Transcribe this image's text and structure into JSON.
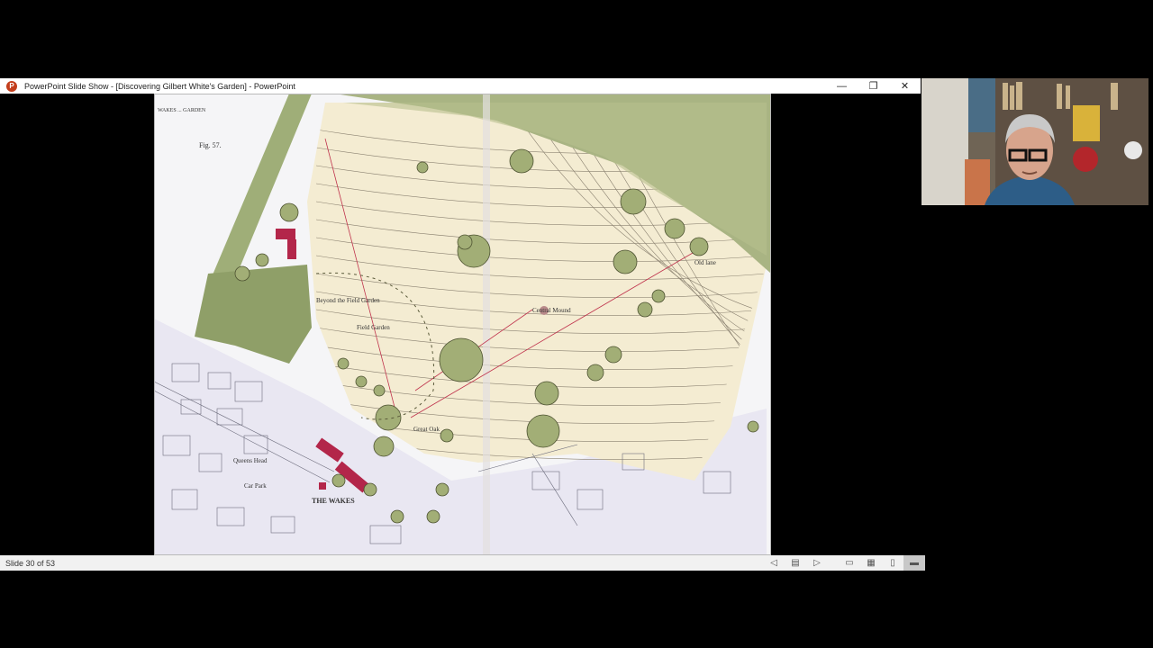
{
  "window": {
    "app_icon": "P",
    "title": "PowerPoint Slide Show - [Discovering Gilbert White's Garden] - PowerPoint",
    "controls": {
      "minimize": "—",
      "restore": "❐",
      "close": "✕"
    }
  },
  "slide": {
    "map_labels": {
      "fig": "Fig. 57.",
      "the_wakes": "THE WAKES",
      "central_mound": "Central Mound",
      "field_garden": "Field Garden",
      "beyond_the_field": "Beyond the Field Garden",
      "great_oak": "Great Oak",
      "old_lane": "Old lane",
      "queens_head": "Queens Head",
      "car_park": "Car Park",
      "wakes_header": "WAKES ... GARDEN"
    }
  },
  "statusbar": {
    "slide_counter": "Slide 30 of 53",
    "icons": [
      "previous-icon",
      "slide-menu-icon",
      "next-icon",
      "normal-view-icon",
      "slide-sorter-icon",
      "reading-view-icon",
      "slideshow-icon"
    ]
  },
  "colors": {
    "titlebar_bg": "#ffffff",
    "statusbar_bg": "#f1f1f1",
    "app_accent": "#c43e1c",
    "map_green": "#9fae78",
    "map_parchment": "#f4ecd2",
    "building_red": "#b3264a"
  }
}
